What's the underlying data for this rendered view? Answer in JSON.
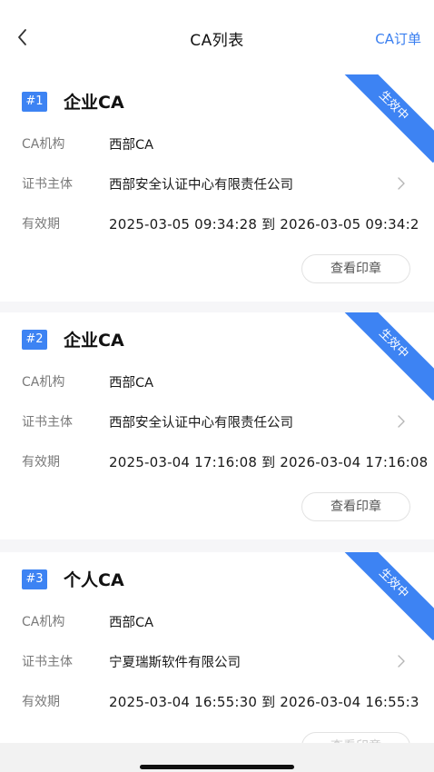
{
  "nav": {
    "title": "CA列表",
    "action": "CA订单",
    "back_icon": "chevron-left-icon"
  },
  "labels": {
    "org": "CA机构",
    "subject": "证书主体",
    "validity": "有效期",
    "view_seal": "查看印章"
  },
  "cards": [
    {
      "index": "#1",
      "title": "企业CA",
      "status": "生效中",
      "org": "西部CA",
      "subject": "西部安全认证中心有限责任公司",
      "validity": "2025-03-05 09:34:28 到 2026-03-05 09:34:2"
    },
    {
      "index": "#2",
      "title": "企业CA",
      "status": "生效中",
      "org": "西部CA",
      "subject": "西部安全认证中心有限责任公司",
      "validity": "2025-03-04 17:16:08 到 2026-03-04 17:16:08"
    },
    {
      "index": "#3",
      "title": "个人CA",
      "status": "生效中",
      "org": "西部CA",
      "subject": "宁夏瑞斯软件有限公司",
      "validity": "2025-03-04 16:55:30 到 2026-03-04 16:55:3"
    }
  ],
  "colors": {
    "accent": "#3d83f3",
    "link": "#3a7ff0"
  }
}
